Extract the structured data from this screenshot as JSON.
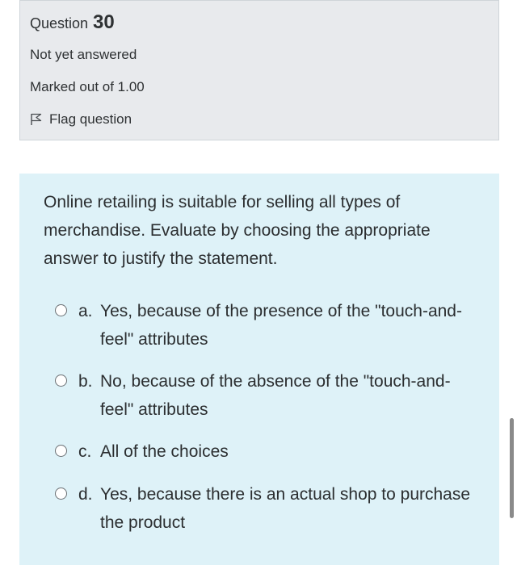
{
  "info": {
    "question_label": "Question",
    "question_number": "30",
    "state": "Not yet answered",
    "grade": "Marked out of 1.00",
    "flag_label": "Flag question"
  },
  "question": {
    "text": "Online retailing is suitable for selling all types of merchandise. Evaluate by choosing the appropriate answer to justify the statement.",
    "options": [
      {
        "letter": "a.",
        "text": "Yes, because of the presence of the \"touch-and-feel\" attributes"
      },
      {
        "letter": "b.",
        "text": "No, because of the absence of the \"touch-and-feel\" attributes"
      },
      {
        "letter": "c.",
        "text": "All of the choices"
      },
      {
        "letter": "d.",
        "text": "Yes, because there is an actual shop to purchase the product"
      }
    ]
  },
  "colors": {
    "info_bg": "#e8eaed",
    "content_bg": "#def2f8"
  },
  "icons": {
    "flag": "flag-icon",
    "radio": "radio-icon"
  }
}
